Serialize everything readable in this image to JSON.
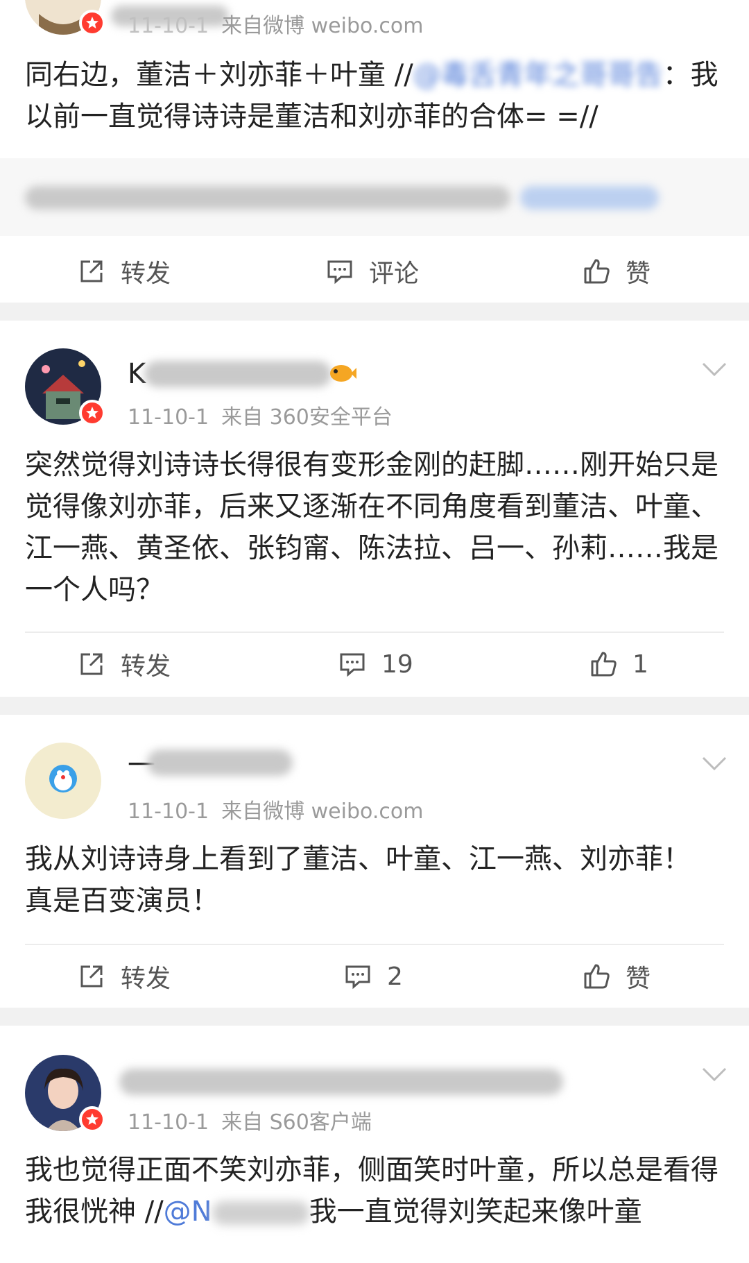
{
  "post0": {
    "meta_date": "11-10-1",
    "meta_source": "来自微博 weibo.com",
    "text_a": "同右边，董洁＋刘亦菲＋叶童 //",
    "mention": "@毒舌青年之哥哥告",
    "text_b": "：我以前一直觉得诗诗是董洁和刘亦菲的合体= =//",
    "repost_label": "转发",
    "comment_label": "评论",
    "like_label": "赞"
  },
  "post1": {
    "username_visible": "K",
    "meta_date": "11-10-1",
    "meta_source": "来自 360安全平台",
    "text": "突然觉得刘诗诗长得很有变形金刚的赶脚……刚开始只是觉得像刘亦菲，后来又逐渐在不同角度看到董洁、叶童、江一燕、黄圣依、张钧甯、陈法拉、吕一、孙莉……我是一个人吗？",
    "repost_label": "转发",
    "comment_count": "19",
    "like_count": "1"
  },
  "post2": {
    "username_visible": "一",
    "meta_date": "11-10-1",
    "meta_source": "来自微博 weibo.com",
    "text": "我从刘诗诗身上看到了董洁、叶童、江一燕、刘亦菲！真是百变演员！",
    "repost_label": "转发",
    "comment_count": "2",
    "like_label": "赞"
  },
  "post3": {
    "meta_date": "11-10-1",
    "meta_source": "来自 S60客户端",
    "text_a": "我也觉得正面不笑刘亦菲，侧面笑时叶童，所以总是看得我很恍神 //",
    "mention": "@N",
    "text_b": "我一直觉得刘笑起来像叶童"
  },
  "colors": {
    "mention": "#4f7bd8",
    "badge": "#ff3b30",
    "meta": "#9a9a9a"
  },
  "icons": [
    "repost-icon",
    "comment-icon",
    "like-icon",
    "chevron-down-icon",
    "verified-badge-icon"
  ]
}
